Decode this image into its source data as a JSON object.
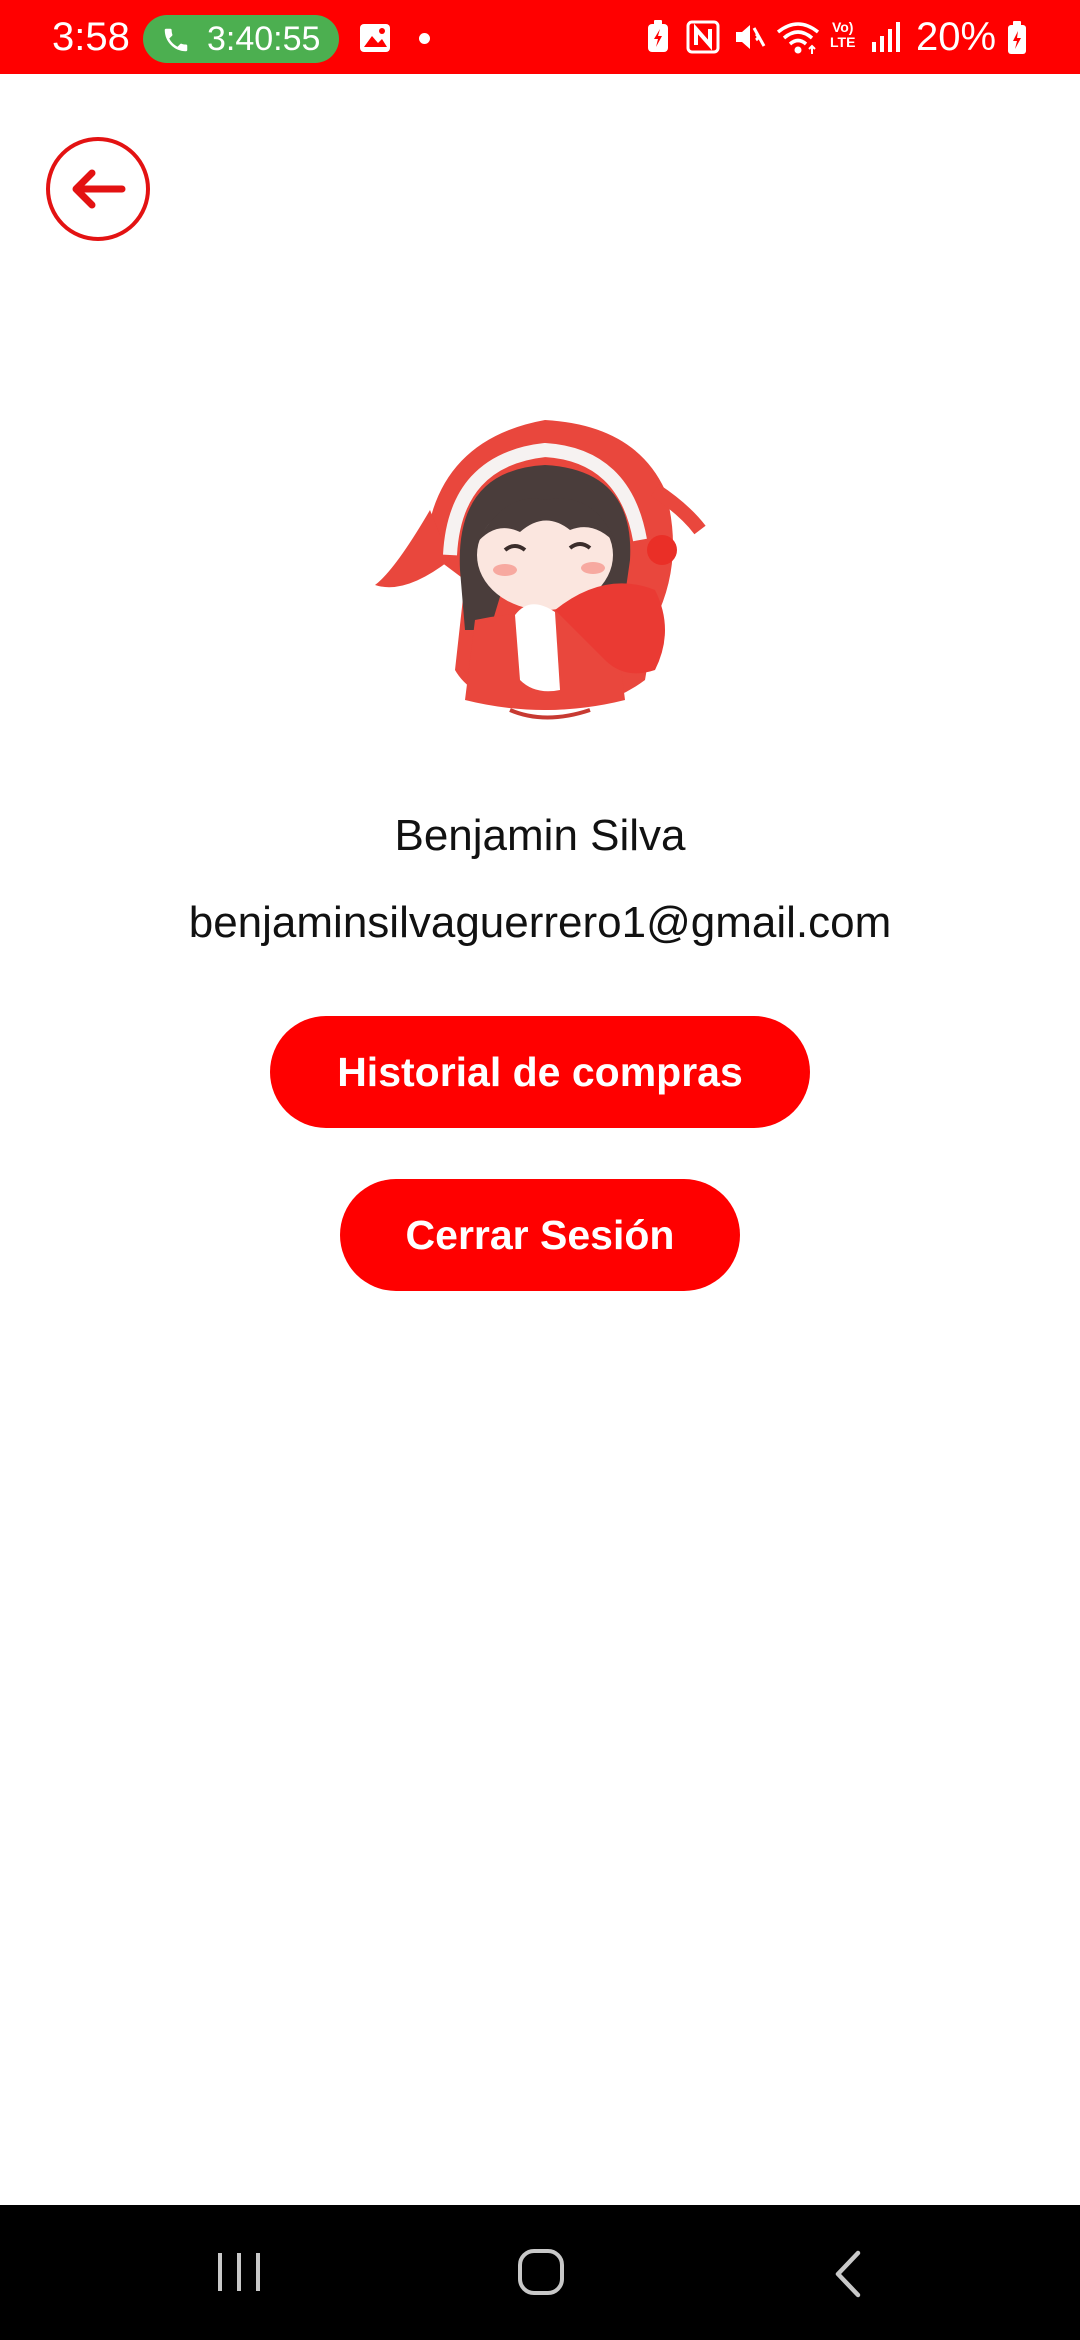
{
  "status_bar": {
    "time": "3:58",
    "call_duration": "3:40:55",
    "volte_line1": "Vo)",
    "volte_line2": "LTE",
    "battery_percent": "20%",
    "icons": [
      "phone-icon",
      "gallery-icon",
      "notification-dot-icon",
      "battery-saver-icon",
      "nfc-icon",
      "mute-icon",
      "wifi-icon",
      "volte-icon",
      "signal-icon",
      "battery-charging-icon"
    ]
  },
  "header": {
    "back_icon": "arrow-left-icon"
  },
  "profile": {
    "avatar": "anime-girl-red-hoodie-avatar",
    "name": "Benjamin Silva",
    "email": "benjaminsilvaguerrero1@gmail.com"
  },
  "actions": {
    "history_label": "Historial de compras",
    "logout_label": "Cerrar Sesión"
  },
  "nav_bar": {
    "icons": [
      "recents-icon",
      "home-icon",
      "back-icon"
    ]
  },
  "colors": {
    "accent": "#ff0000",
    "call_pill": "#4caf50",
    "text": "#111111",
    "nav_bar": "#000000"
  }
}
